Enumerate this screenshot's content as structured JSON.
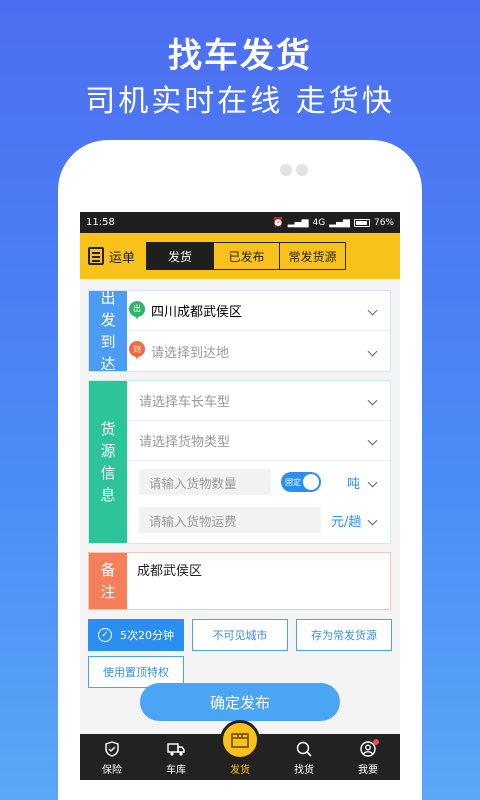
{
  "promo": {
    "title": "找车发货",
    "subtitle": "司机实时在线 走货快"
  },
  "status_bar": {
    "time": "11:58",
    "network": "4G",
    "battery": "76%"
  },
  "header": {
    "waybill_label": "运单",
    "tabs": [
      {
        "label": "发货",
        "active": true
      },
      {
        "label": "已发布",
        "active": false
      },
      {
        "label": "常发货源",
        "active": false
      }
    ]
  },
  "route": {
    "side_label": "出发到达",
    "origin": {
      "badge": "出",
      "value": "四川成都武侯区",
      "color": "#2fb56a"
    },
    "destination": {
      "badge": "到",
      "placeholder": "请选择到达地",
      "color": "#f06b3c"
    }
  },
  "cargo": {
    "side_label": "货源信息",
    "vehicle_placeholder": "请选择车长车型",
    "type_placeholder": "请选择货物类型",
    "quantity_placeholder": "请输入货物数量",
    "fixed_toggle": "固定",
    "quantity_unit": "吨",
    "freight_placeholder": "请输入货物运费",
    "freight_unit": "元/趟"
  },
  "remark": {
    "side_label": "备注",
    "value": "成都武侯区"
  },
  "options": {
    "times_button": "5次20分钟",
    "hidden_city_button": "不可见城市",
    "save_common_button": "存为常发货源",
    "pin_top_button": "使用置顶特权"
  },
  "submit_button": "确定发布",
  "tabbar": [
    {
      "label": "保险",
      "icon": "shield-icon"
    },
    {
      "label": "车库",
      "icon": "truck-icon"
    },
    {
      "label": "发货",
      "icon": "box-icon"
    },
    {
      "label": "找货",
      "icon": "search-chat-icon"
    },
    {
      "label": "我要",
      "icon": "user-icon"
    }
  ],
  "colors": {
    "accent": "#f9c21b",
    "route": "#4a9df2",
    "cargo": "#2cc49a",
    "remark": "#f47f5a",
    "primary": "#4aa6f4"
  }
}
